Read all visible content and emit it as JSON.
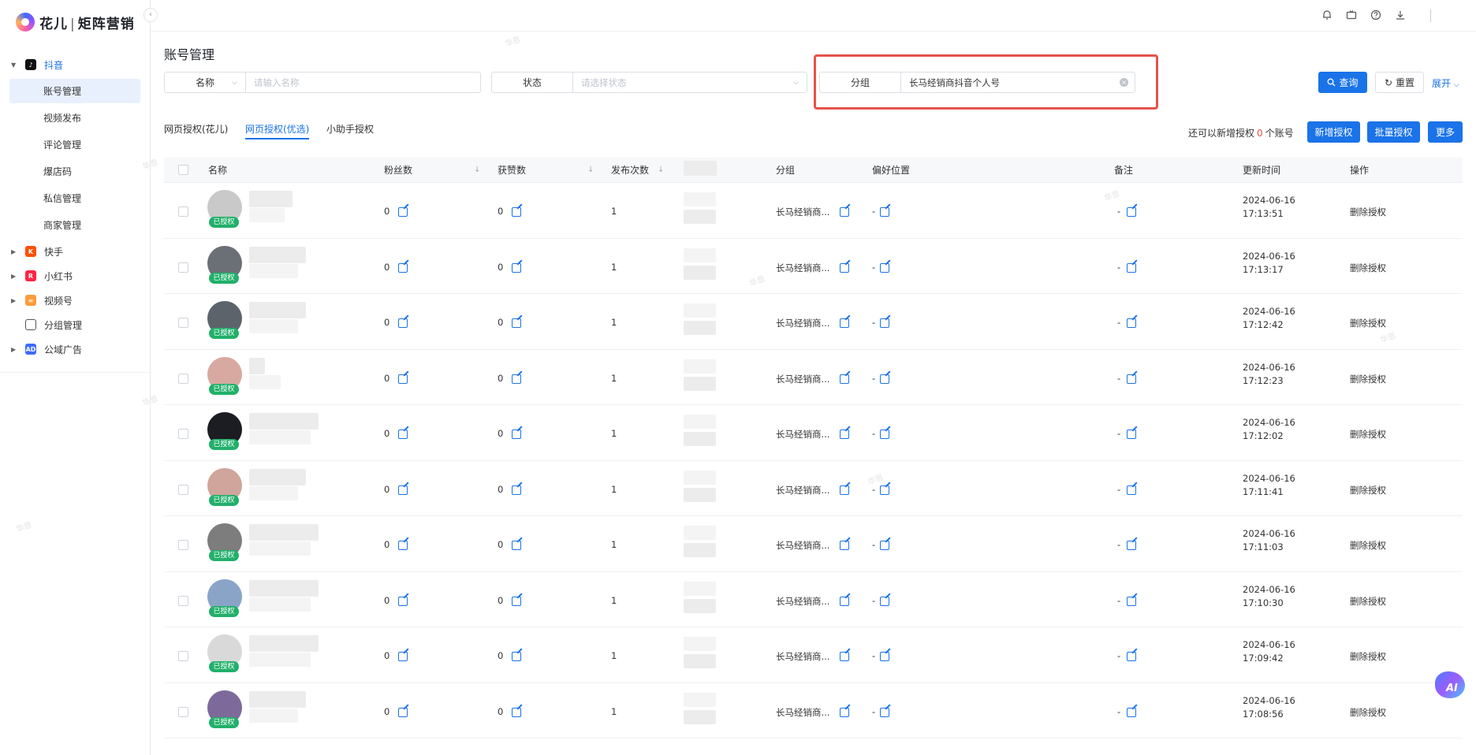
{
  "brand": {
    "name": "花儿",
    "separator": "|",
    "product": "矩阵营销"
  },
  "sidebar": {
    "groups": [
      {
        "id": "douyin",
        "label": "抖音",
        "icon_color": "#111111",
        "icon_glyph": "♪",
        "expanded": true,
        "active": true,
        "children": [
          "账号管理",
          "视频发布",
          "评论管理",
          "爆店码",
          "私信管理",
          "商家管理"
        ]
      },
      {
        "id": "kuaishou",
        "label": "快手",
        "icon_color": "#ff5000",
        "icon_glyph": "K"
      },
      {
        "id": "xiaohongshu",
        "label": "小红书",
        "icon_color": "#ff2442",
        "icon_glyph": "R"
      },
      {
        "id": "shipinhao",
        "label": "视频号",
        "icon_color": "#fa9d3b",
        "icon_glyph": "∞"
      },
      {
        "id": "group",
        "label": "分组管理",
        "icon_color": "#555555",
        "icon_glyph": "▭"
      },
      {
        "id": "ads",
        "label": "公域广告",
        "icon_color": "#3d6bff",
        "icon_glyph": "AD"
      }
    ],
    "active_child": "账号管理"
  },
  "topbar": {
    "icons": [
      "bell-icon",
      "tv-icon",
      "help-icon",
      "download-icon"
    ]
  },
  "page": {
    "title": "账号管理"
  },
  "filters": {
    "name": {
      "label": "名称",
      "placeholder": "请输入名称"
    },
    "status": {
      "label": "状态",
      "placeholder": "请选择状态"
    },
    "group": {
      "label": "分组",
      "value": "长马经销商抖音个人号"
    }
  },
  "actions": {
    "query": "查询",
    "reset": "重置",
    "expand": "展开"
  },
  "tabs": [
    "网页授权(花儿)",
    "网页授权(优选)",
    "小助手授权"
  ],
  "active_tab": 1,
  "quota": {
    "prefix": "还可以新增授权",
    "count": "0",
    "suffix": "个账号"
  },
  "buttons": {
    "add_auth": "新增授权",
    "batch_auth": "批量授权",
    "more": "更多"
  },
  "table": {
    "headers": {
      "name": "名称",
      "fans": "粉丝数",
      "likes": "获赞数",
      "posts": "发布次数",
      "group": "分组",
      "pref": "偏好位置",
      "remark": "备注",
      "updated": "更新时间",
      "ops": "操作"
    },
    "auth_badge": "已授权",
    "delete_label": "删除授权",
    "rows": [
      {
        "fans": "0",
        "likes": "0",
        "posts": "1",
        "group": "长马经销商...",
        "pref": "-",
        "remark": "-",
        "date": "2024-06-16",
        "time": "17:13:51",
        "avatar": "#c9c9c9"
      },
      {
        "fans": "0",
        "likes": "0",
        "posts": "1",
        "group": "长马经销商...",
        "pref": "-",
        "remark": "-",
        "date": "2024-06-16",
        "time": "17:13:17",
        "avatar": "#6b6f76"
      },
      {
        "fans": "0",
        "likes": "0",
        "posts": "1",
        "group": "长马经销商...",
        "pref": "-",
        "remark": "-",
        "date": "2024-06-16",
        "time": "17:12:42",
        "avatar": "#5d636b"
      },
      {
        "fans": "0",
        "likes": "0",
        "posts": "1",
        "group": "长马经销商...",
        "pref": "-",
        "remark": "-",
        "date": "2024-06-16",
        "time": "17:12:23",
        "avatar": "#d8a9a0"
      },
      {
        "fans": "0",
        "likes": "0",
        "posts": "1",
        "group": "长马经销商...",
        "pref": "-",
        "remark": "-",
        "date": "2024-06-16",
        "time": "17:12:02",
        "avatar": "#1c1d22"
      },
      {
        "fans": "0",
        "likes": "0",
        "posts": "1",
        "group": "长马经销商...",
        "pref": "-",
        "remark": "-",
        "date": "2024-06-16",
        "time": "17:11:41",
        "avatar": "#cfa59c"
      },
      {
        "fans": "0",
        "likes": "0",
        "posts": "1",
        "group": "长马经销商...",
        "pref": "-",
        "remark": "-",
        "date": "2024-06-16",
        "time": "17:11:03",
        "avatar": "#7d7d7d"
      },
      {
        "fans": "0",
        "likes": "0",
        "posts": "1",
        "group": "长马经销商...",
        "pref": "-",
        "remark": "-",
        "date": "2024-06-16",
        "time": "17:10:30",
        "avatar": "#8aa4c8"
      },
      {
        "fans": "0",
        "likes": "0",
        "posts": "1",
        "group": "长马经销商...",
        "pref": "-",
        "remark": "-",
        "date": "2024-06-16",
        "time": "17:09:42",
        "avatar": "#d9d9d9"
      },
      {
        "fans": "0",
        "likes": "0",
        "posts": "1",
        "group": "长马经销商...",
        "pref": "-",
        "remark": "-",
        "date": "2024-06-16",
        "time": "17:08:56",
        "avatar": "#7d6a9a"
      }
    ]
  },
  "ai_assistant": {
    "label": "AI"
  },
  "colors": {
    "primary": "#1a73e8",
    "success": "#21b06a",
    "highlight": "#e5534b"
  }
}
